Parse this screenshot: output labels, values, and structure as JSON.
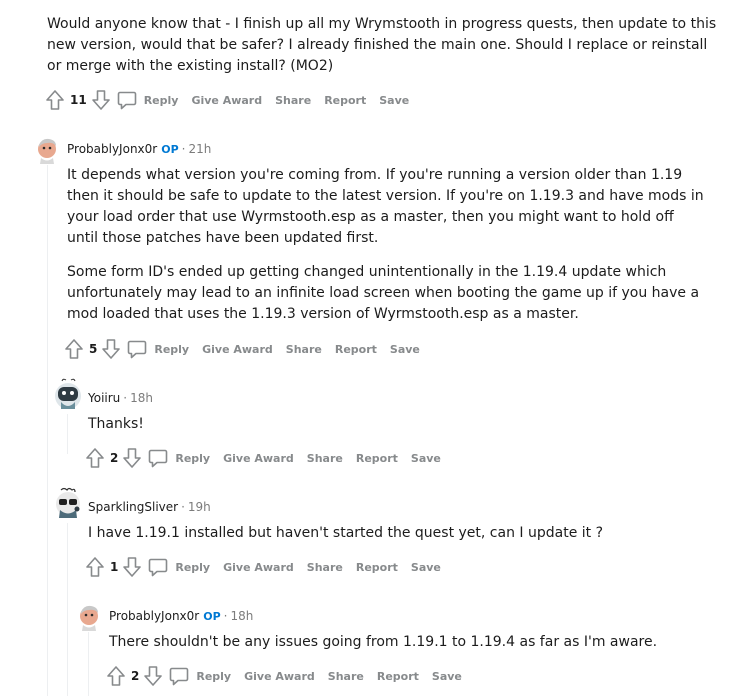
{
  "top_comment": {
    "text": "Would anyone know that - I finish up all my Wrymstooth in progress quests, then update to this new version, would that be safer? I already finished the main one. Should I replace or reinstall or merge with the existing install? (MO2)",
    "score": "11"
  },
  "actions": {
    "reply": "Reply",
    "give_award": "Give Award",
    "share": "Share",
    "report": "Report",
    "save": "Save"
  },
  "comments": [
    {
      "author": "ProbablyJonx0r",
      "op_badge": "OP",
      "time": "21h",
      "paragraphs": [
        "It depends what version you're coming from. If you're running a version older than 1.19 then it should be safe to update to the latest version. If you're on 1.19.3 and have mods in your load order that use Wyrmstooth.esp as a master, then you might want to hold off until those patches have been updated first.",
        "Some form ID's ended up getting changed unintentionally in the 1.19.4 update which unfortunately may lead to an infinite load screen when booting the game up if you have a mod loaded that uses the 1.19.3 version of Wyrmstooth.esp as a master."
      ],
      "score": "5"
    },
    {
      "author": "Yoiiru",
      "time": "18h",
      "paragraphs": [
        "Thanks!"
      ],
      "score": "2"
    },
    {
      "author": "SparklingSliver",
      "time": "19h",
      "paragraphs": [
        "I have 1.19.1 installed but haven't started the quest yet, can I update it ?"
      ],
      "score": "1"
    },
    {
      "author": "ProbablyJonx0r",
      "op_badge": "OP",
      "time": "18h",
      "paragraphs": [
        "There shouldn't be any issues going from 1.19.1 to 1.19.4 as far as I'm aware."
      ],
      "score": "2"
    }
  ],
  "time_separator": "·",
  "colors": {
    "op": "#0079d3",
    "meta": "#7c7c7c",
    "action": "#878a8c",
    "thread_line": "#edeff1"
  }
}
